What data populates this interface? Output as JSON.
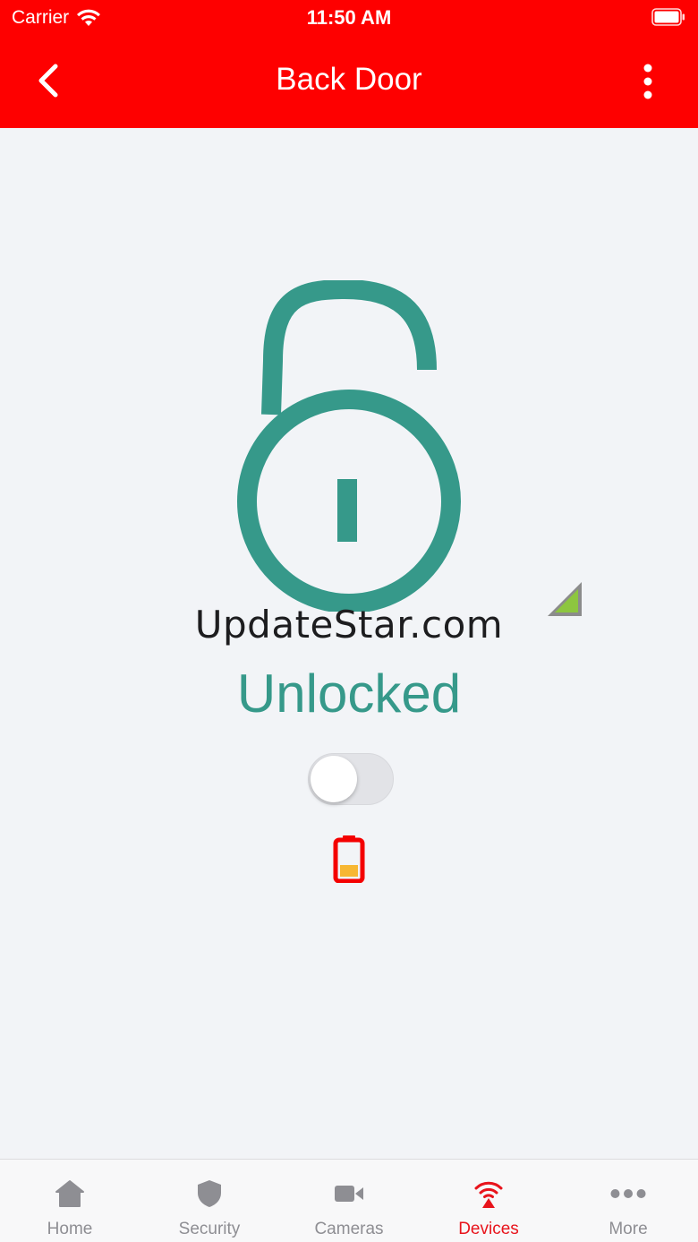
{
  "status_bar": {
    "carrier": "Carrier",
    "time": "11:50 AM"
  },
  "nav": {
    "title": "Back Door",
    "back_icon": "chevron-left-icon",
    "menu_icon": "more-vertical-icon"
  },
  "device": {
    "lock_icon": "unlocked-padlock-icon",
    "watermark": "UpdateStar.com",
    "state": "Unlocked",
    "toggle_on": false,
    "battery_icon": "low-battery-icon",
    "signal_icon": "signal-strength-icon"
  },
  "colors": {
    "brand_red": "#fe0000",
    "lock_green": "#36998a",
    "tab_active": "#e8141c",
    "tab_inactive": "#8e8e93",
    "background": "#f2f4f7"
  },
  "tabs": [
    {
      "label": "Home",
      "icon": "home-icon",
      "active": false
    },
    {
      "label": "Security",
      "icon": "shield-icon",
      "active": false
    },
    {
      "label": "Cameras",
      "icon": "video-camera-icon",
      "active": false
    },
    {
      "label": "Devices",
      "icon": "wireless-device-icon",
      "active": true
    },
    {
      "label": "More",
      "icon": "more-horizontal-icon",
      "active": false
    }
  ]
}
